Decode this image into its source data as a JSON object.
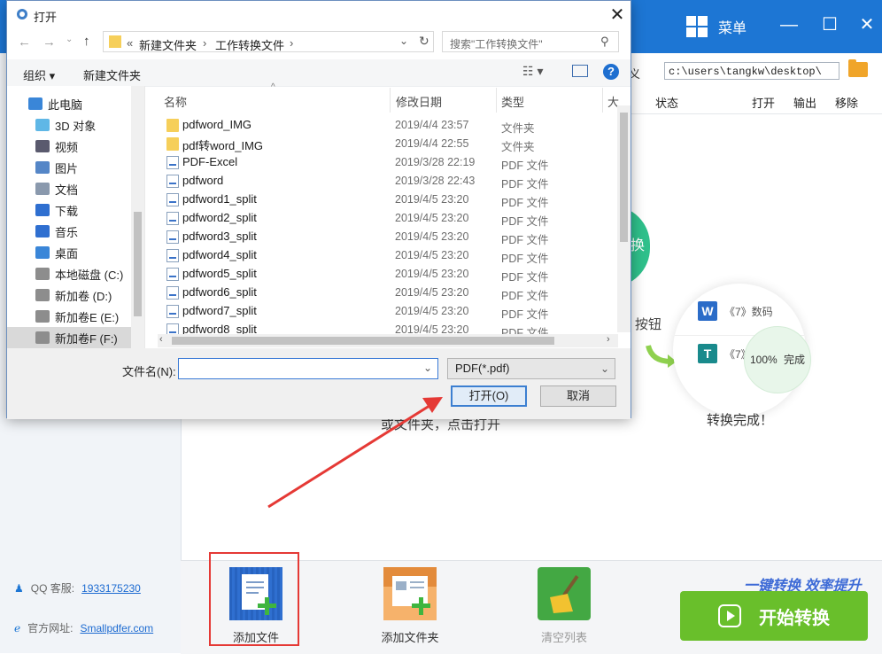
{
  "app": {
    "menu_label": "菜单",
    "path_label": "义",
    "path_value": "c:\\users\\tangkw\\desktop\\",
    "columns": [
      "状态",
      "打开",
      "输出",
      "移除"
    ],
    "circle_text": "换",
    "hint_button": "按钮",
    "demo_rows": [
      {
        "icon": "W",
        "text": "《7》数码"
      },
      {
        "icon": "T",
        "text": "《7》"
      }
    ],
    "progress": "100%",
    "progress_label": "完成",
    "done_text": "转换完成！",
    "drop_hint": "或文件夹，点击打开",
    "tools": [
      {
        "label": "添加文件"
      },
      {
        "label": "添加文件夹"
      },
      {
        "label": "清空列表"
      }
    ],
    "slogan": "一键转换  效率提升",
    "start_label": "开始转换",
    "qq_label": "QQ 客服:",
    "qq_value": "1933175230",
    "site_label": "官方网址:",
    "site_value": "Smallpdfer.com",
    "colors": {
      "brand_blue": "#1d76d4",
      "start_green": "#69bf2b",
      "highlight_red": "#e53935"
    }
  },
  "dialog": {
    "title": "打开",
    "breadcrumb": [
      "«",
      "新建文件夹",
      "›",
      "工作转换文件",
      "›"
    ],
    "search_placeholder": "搜索\"工作转换文件\"",
    "organize": "组织 ▾",
    "new_folder": "新建文件夹",
    "tree": [
      {
        "label": "此电脑",
        "icon": "computer-icon"
      },
      {
        "label": "3D 对象",
        "icon": "cube-icon"
      },
      {
        "label": "视频",
        "icon": "video-icon"
      },
      {
        "label": "图片",
        "icon": "picture-icon"
      },
      {
        "label": "文档",
        "icon": "document-icon"
      },
      {
        "label": "下载",
        "icon": "download-icon"
      },
      {
        "label": "音乐",
        "icon": "music-icon"
      },
      {
        "label": "桌面",
        "icon": "desktop-icon"
      },
      {
        "label": "本地磁盘 (C:)",
        "icon": "drive-icon"
      },
      {
        "label": "新加卷 (D:)",
        "icon": "drive-icon"
      },
      {
        "label": "新加卷E (E:)",
        "icon": "drive-icon"
      },
      {
        "label": "新加卷F (F:)",
        "icon": "drive-icon"
      }
    ],
    "headers": {
      "name": "名称",
      "date": "修改日期",
      "type": "类型",
      "size": "大"
    },
    "files": [
      {
        "name": "pdfword_IMG",
        "date": "2019/4/4 23:57",
        "type": "文件夹",
        "kind": "folder"
      },
      {
        "name": "pdf转word_IMG",
        "date": "2019/4/4 22:55",
        "type": "文件夹",
        "kind": "folder"
      },
      {
        "name": "PDF-Excel",
        "date": "2019/3/28 22:19",
        "type": "PDF 文件",
        "kind": "pdf"
      },
      {
        "name": "pdfword",
        "date": "2019/3/28 22:43",
        "type": "PDF 文件",
        "kind": "pdf"
      },
      {
        "name": "pdfword1_split",
        "date": "2019/4/5 23:20",
        "type": "PDF 文件",
        "kind": "pdf"
      },
      {
        "name": "pdfword2_split",
        "date": "2019/4/5 23:20",
        "type": "PDF 文件",
        "kind": "pdf"
      },
      {
        "name": "pdfword3_split",
        "date": "2019/4/5 23:20",
        "type": "PDF 文件",
        "kind": "pdf"
      },
      {
        "name": "pdfword4_split",
        "date": "2019/4/5 23:20",
        "type": "PDF 文件",
        "kind": "pdf"
      },
      {
        "name": "pdfword5_split",
        "date": "2019/4/5 23:20",
        "type": "PDF 文件",
        "kind": "pdf"
      },
      {
        "name": "pdfword6_split",
        "date": "2019/4/5 23:20",
        "type": "PDF 文件",
        "kind": "pdf"
      },
      {
        "name": "pdfword7_split",
        "date": "2019/4/5 23:20",
        "type": "PDF 文件",
        "kind": "pdf"
      },
      {
        "name": "pdfword8_split",
        "date": "2019/4/5 23:20",
        "type": "PDF 文件",
        "kind": "pdf"
      }
    ],
    "filename_label": "文件名(N):",
    "filename_value": "",
    "filetype": "PDF(*.pdf)",
    "open_label": "打开(O)",
    "cancel_label": "取消"
  }
}
